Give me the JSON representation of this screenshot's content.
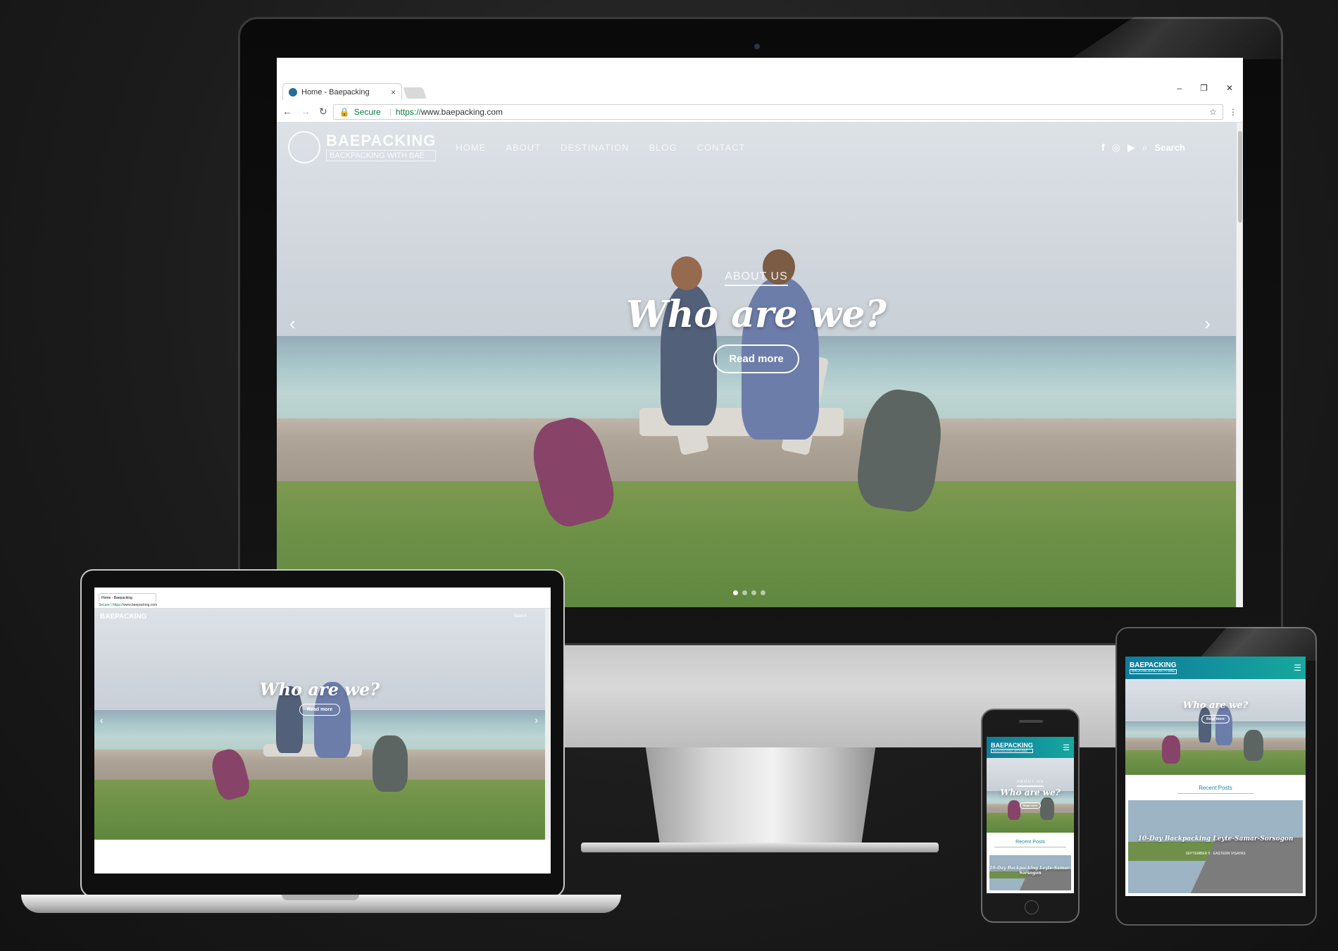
{
  "browser": {
    "tab_title": "Home - Baepacking",
    "tab_close": "×",
    "win_minimize": "–",
    "win_restore": "❐",
    "win_close": "✕",
    "secure_label": "Secure",
    "url_scheme": "https://",
    "url_host": "www.baepacking.com",
    "back": "←",
    "forward": "→",
    "reload": "↻",
    "bookmark": "☆",
    "menu": "⋮"
  },
  "site": {
    "logo_name": "BAEPACKING",
    "logo_tagline": "BACKPACKING WITH BAE",
    "menu": [
      "HOME",
      "ABOUT",
      "DESTINATION",
      "BLOG",
      "CONTACT"
    ],
    "social_icons": [
      "facebook-icon",
      "instagram-icon",
      "youtube-icon"
    ],
    "search_label": "Search",
    "hero": {
      "eyebrow": "ABOUT US",
      "headline": "Who are we?",
      "cta": "Read more",
      "prev": "‹",
      "next": "›",
      "slide_count": 4,
      "active_slide": 1
    },
    "mobile_menu_icon": "☰",
    "recent_posts_label": "Recent Posts",
    "post_title": "10-Day Backpacking Leyte-Samar-Sorsogon",
    "post_meta": "SEPTEMBER 5 · EASTERN VISAYAS"
  },
  "colors": {
    "brand_teal": "#16a89d",
    "brand_blue": "#0f7c9c",
    "secure_green": "#0b8043",
    "recent_posts": "#1a8aa0"
  }
}
